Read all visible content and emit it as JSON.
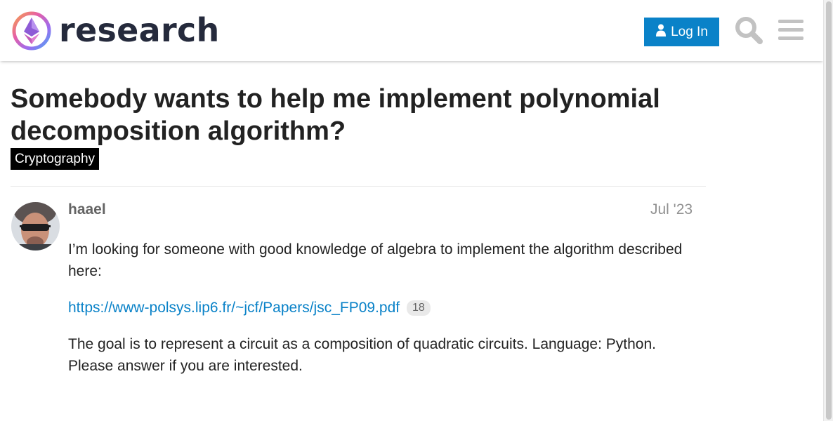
{
  "header": {
    "brand_name": "research",
    "login_label": "Log In",
    "icons": {
      "logo": "ethereum-logo-icon",
      "user": "user-icon",
      "search": "search-icon",
      "menu": "hamburger-menu-icon"
    }
  },
  "topic": {
    "title": "Somebody wants to help me implement polynomial decomposition algorithm?",
    "category": "Cryptography"
  },
  "post": {
    "username": "haael",
    "date": "Jul '23",
    "paragraph1": "I’m looking for someone with good knowledge of algebra to implement the algorithm described here:",
    "link_text": "https://www-polsys.lip6.fr/~jcf/Papers/jsc_FP09.pdf",
    "link_clicks": "18",
    "paragraph2": "The goal is to represent a circuit as a composition of quadratic circuits. Language: Python. Please answer if you are interested."
  },
  "colors": {
    "accent": "#0a82c8",
    "category_badge": "#000000",
    "brand_text": "#252a3c",
    "muted_text": "#919191"
  }
}
